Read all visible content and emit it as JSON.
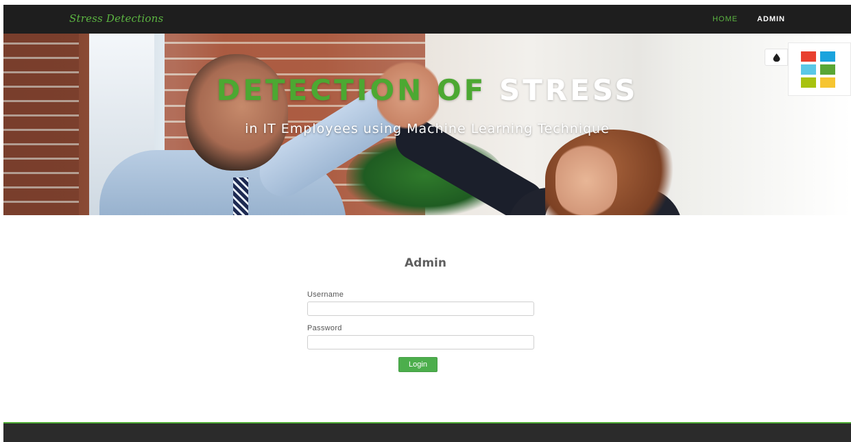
{
  "navbar": {
    "brand": "Stress Detections",
    "links": [
      {
        "label": "HOME",
        "active": true
      },
      {
        "label": "ADMIN",
        "active": false
      }
    ]
  },
  "hero": {
    "title_part1": "DETECTION OF",
    "title_part2": "STRESS",
    "subtitle": "in IT Employees using Machine Learning Technique"
  },
  "palette": {
    "toggle_icon": "droplet-icon",
    "swatches": [
      "#e8402f",
      "#1aa3dd",
      "#5bc8e6",
      "#5aa635",
      "#a8c20f",
      "#f6c531"
    ]
  },
  "login": {
    "title": "Admin",
    "username_label": "Username",
    "username_value": "",
    "password_label": "Password",
    "password_value": "",
    "button_label": "Login"
  },
  "colors": {
    "accent": "#4ca832",
    "navbar_bg": "#1e1e1e",
    "footer_bg": "#2b2b2b",
    "button": "#4cae4c"
  }
}
